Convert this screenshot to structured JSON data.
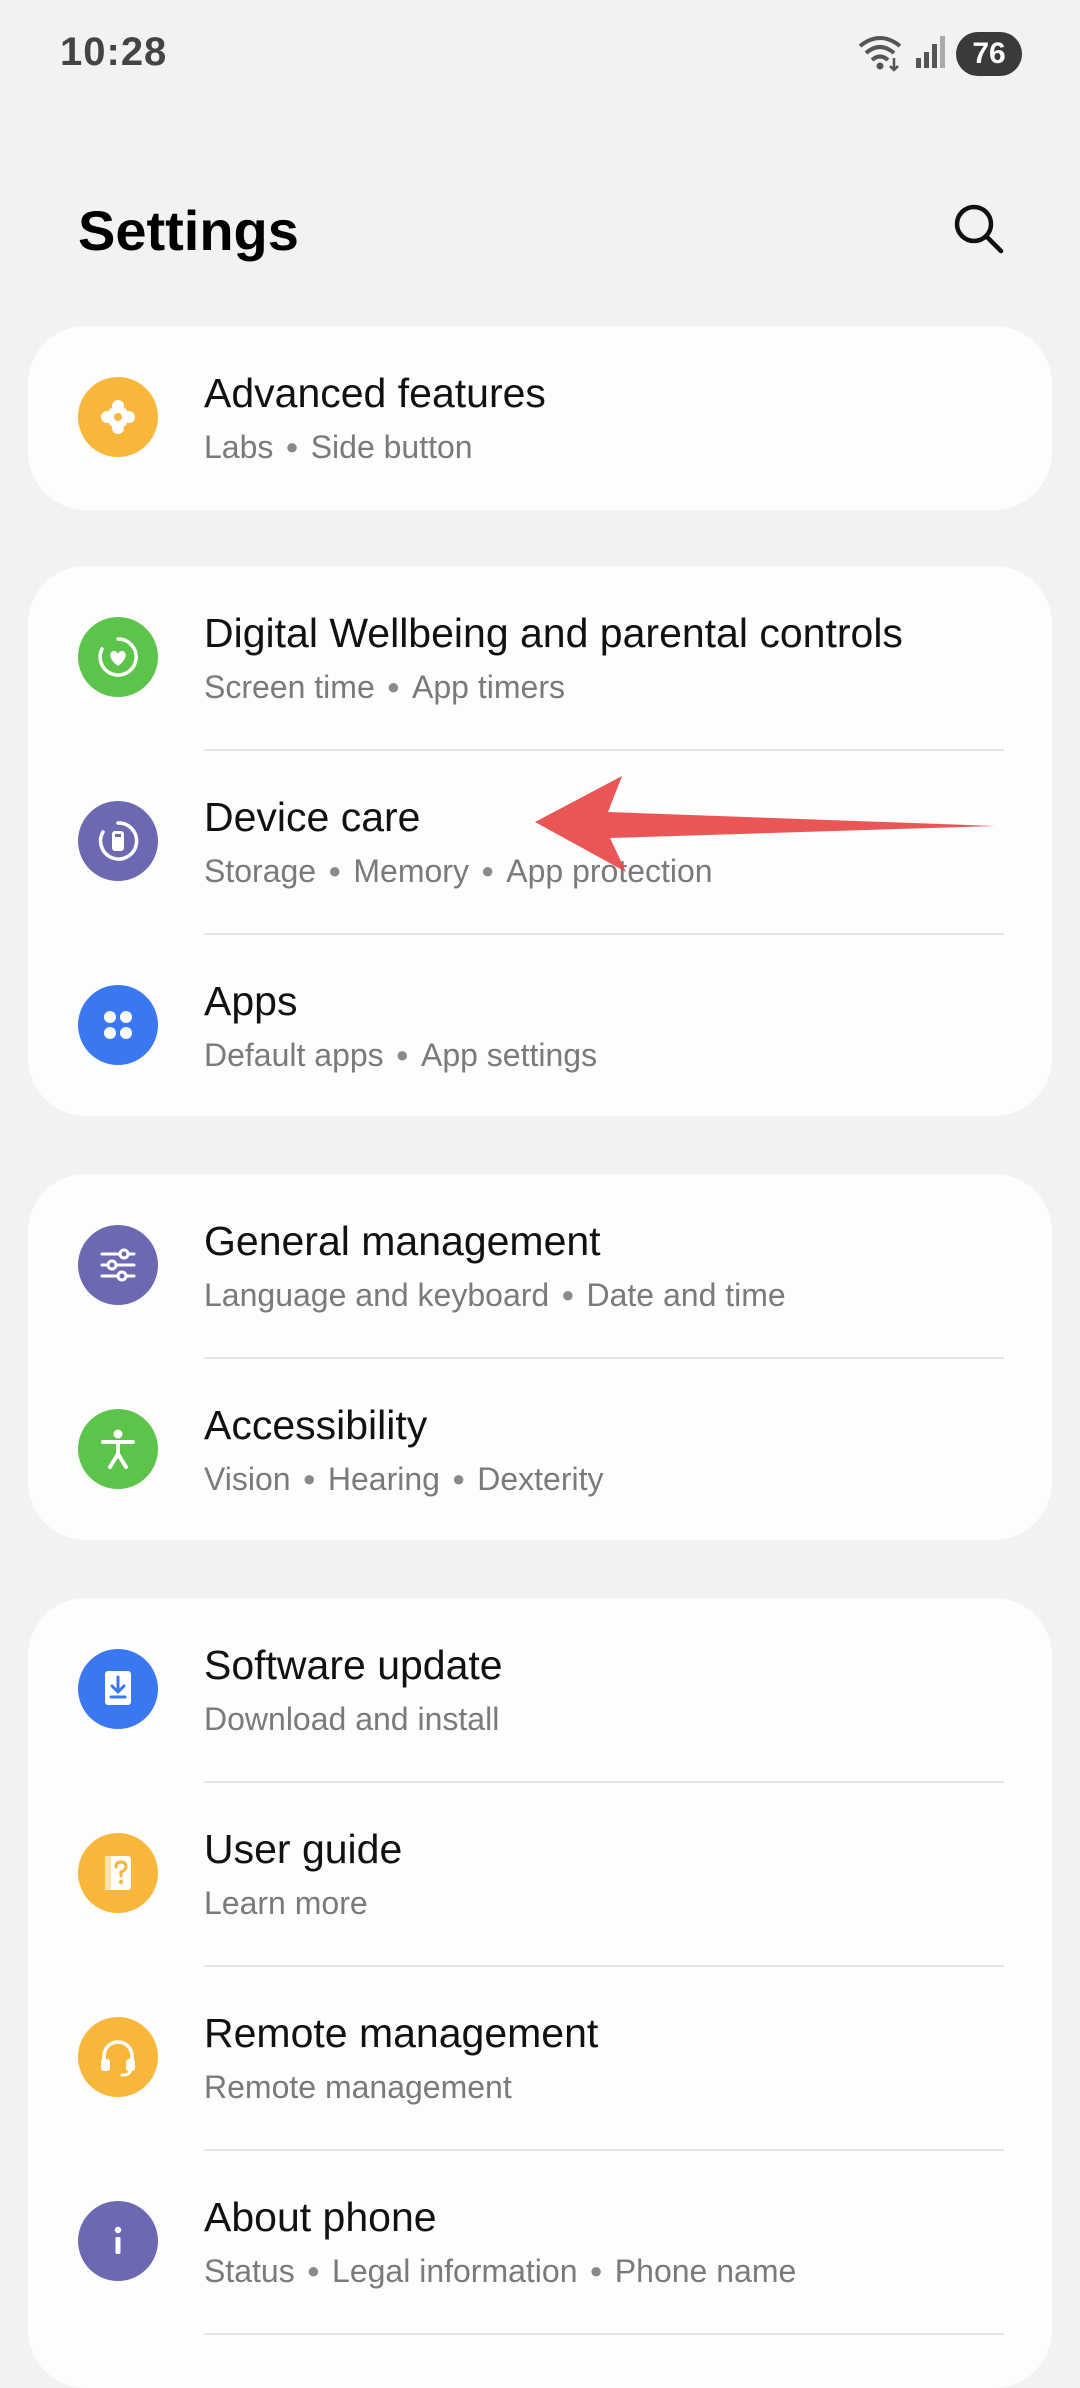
{
  "status_bar": {
    "time": "10:28",
    "battery": "76"
  },
  "header": {
    "title": "Settings"
  },
  "colors": {
    "background": "#f2f1f3",
    "card": "#fdfdfd",
    "orange": "#f8b63a",
    "green": "#5cc44a",
    "purple": "#6d68b2",
    "blue": "#3a78f2",
    "arrow": "#e94c4c"
  },
  "icons": {
    "search": "search-icon",
    "advanced_features": "puzzle-icon",
    "digital_wellbeing": "wellbeing-heart-icon",
    "device_care": "device-care-icon",
    "apps": "apps-grid-icon",
    "general_management": "sliders-icon",
    "accessibility": "accessibility-person-icon",
    "software_update": "download-icon",
    "user_guide": "help-book-icon",
    "remote_management": "headset-icon",
    "about_phone": "info-icon"
  },
  "cards": [
    {
      "items": [
        {
          "title": "Advanced features",
          "subtitle": [
            "Labs",
            "Side button"
          ]
        }
      ]
    },
    {
      "items": [
        {
          "title": "Digital Wellbeing and parental controls",
          "subtitle": [
            "Screen time",
            "App timers"
          ]
        },
        {
          "title": "Device care",
          "subtitle": [
            "Storage",
            "Memory",
            "App protection"
          ]
        },
        {
          "title": "Apps",
          "subtitle": [
            "Default apps",
            "App settings"
          ]
        }
      ]
    },
    {
      "items": [
        {
          "title": "General management",
          "subtitle": [
            "Language and keyboard",
            "Date and time"
          ]
        },
        {
          "title": "Accessibility",
          "subtitle": [
            "Vision",
            "Hearing",
            "Dexterity"
          ]
        }
      ]
    },
    {
      "items": [
        {
          "title": "Software update",
          "subtitle": [
            "Download and install"
          ]
        },
        {
          "title": "User guide",
          "subtitle": [
            "Learn more"
          ]
        },
        {
          "title": "Remote management",
          "subtitle": [
            "Remote management"
          ]
        },
        {
          "title": "About phone",
          "subtitle": [
            "Status",
            "Legal information",
            "Phone name"
          ]
        }
      ]
    }
  ]
}
